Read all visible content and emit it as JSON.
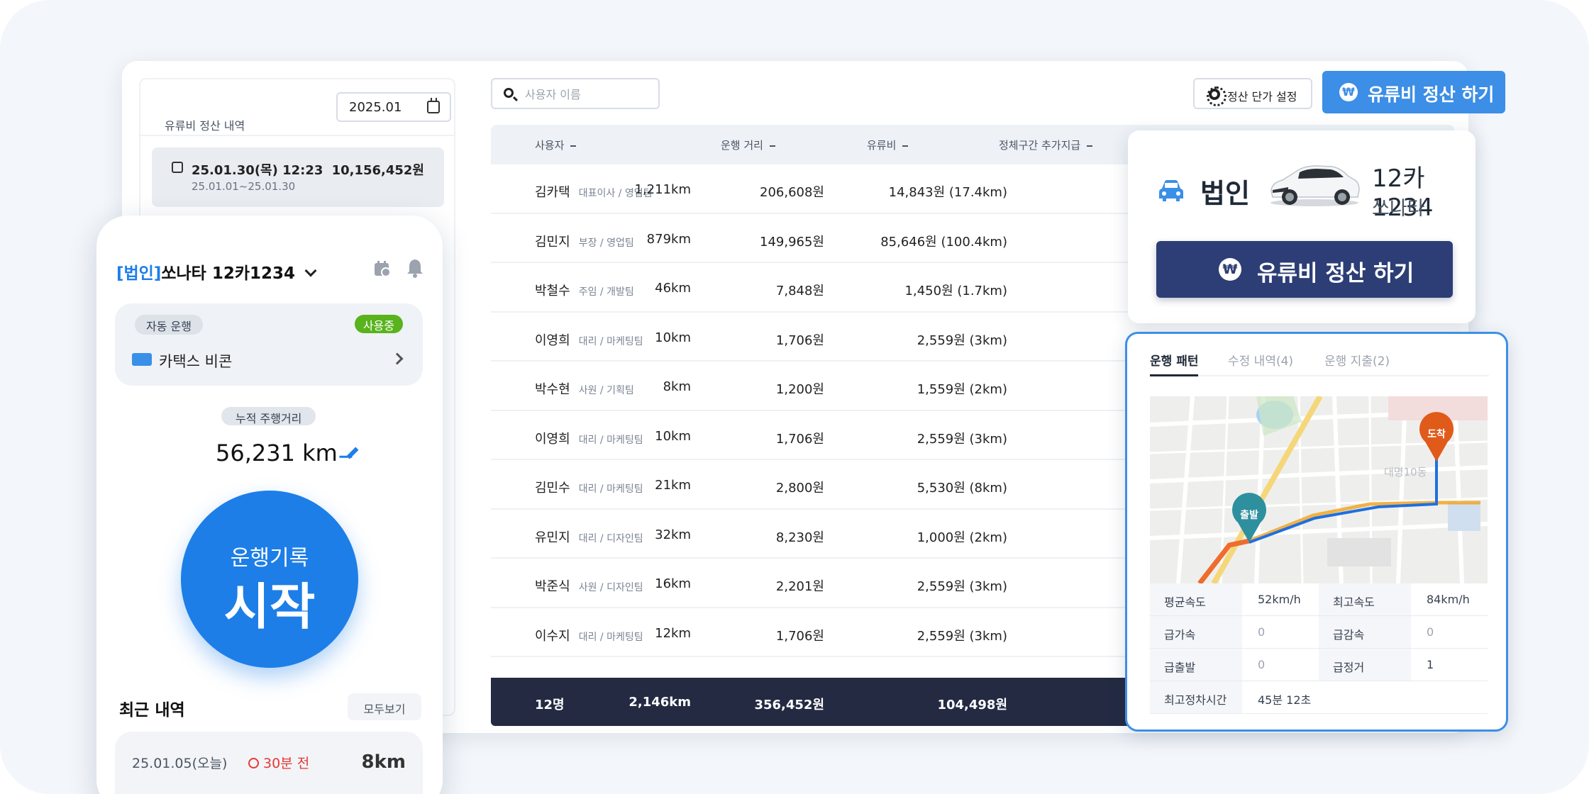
{
  "left_panel": {
    "title": "유류비 정산 내역",
    "month": "2025.01",
    "item": {
      "datetime": "25.01.30(목) 12:23",
      "range": "25.01.01~25.01.30",
      "amount": "10,156,452원"
    }
  },
  "search": {
    "placeholder": "사용자 이름"
  },
  "toolbar": {
    "settings_label": "정산 단가 설정",
    "settle_label": "유류비 정산 하기"
  },
  "table": {
    "headers": [
      "사용자",
      "운행 거리",
      "유류비",
      "정체구간 추가지급"
    ],
    "rows": [
      {
        "name": "김카택",
        "role": "대표이사 / 영업팀",
        "distance": "1,211km",
        "fuel": "206,608원",
        "extra": "14,843원 (17.4km)"
      },
      {
        "name": "김민지",
        "role": "부장 / 영업팀",
        "distance": "879km",
        "fuel": "149,965원",
        "extra": "85,646원 (100.4km)"
      },
      {
        "name": "박철수",
        "role": "주임 / 개발팀",
        "distance": "46km",
        "fuel": "7,848원",
        "extra": "1,450원 (1.7km)"
      },
      {
        "name": "이영희",
        "role": "대리 / 마케팅팀",
        "distance": "10km",
        "fuel": "1,706원",
        "extra": "2,559원 (3km)"
      },
      {
        "name": "박수현",
        "role": "사원 / 기획팀",
        "distance": "8km",
        "fuel": "1,200원",
        "extra": "1,559원 (2km)"
      },
      {
        "name": "이영희",
        "role": "대리 / 마케팅팀",
        "distance": "10km",
        "fuel": "1,706원",
        "extra": "2,559원 (3km)"
      },
      {
        "name": "김민수",
        "role": "대리 / 마케팅팀",
        "distance": "21km",
        "fuel": "2,800원",
        "extra": "5,530원 (8km)"
      },
      {
        "name": "유민지",
        "role": "대리 / 디자인팀",
        "distance": "32km",
        "fuel": "8,230원",
        "extra": "1,000원 (2km)"
      },
      {
        "name": "박준식",
        "role": "사원 / 디자인팀",
        "distance": "16km",
        "fuel": "2,201원",
        "extra": "2,559원 (3km)"
      },
      {
        "name": "이수지",
        "role": "대리 / 마케팅팀",
        "distance": "12km",
        "fuel": "1,706원",
        "extra": "2,559원 (3km)"
      }
    ],
    "footer": {
      "count": "12명",
      "distance": "2,146km",
      "fuel": "356,452원",
      "extra": "104,498원"
    }
  },
  "car_card": {
    "kind": "법인",
    "plate": "12카1234",
    "model": "쏘나타",
    "settle_label": "유류비 정산 하기",
    "won_symbol": "₩"
  },
  "trip_card": {
    "tabs": [
      "운행 패턴",
      "수정 내역(4)",
      "운행 지출(2)"
    ],
    "map": {
      "start_label": "출발",
      "end_label": "도착",
      "area_label": "대명10동"
    },
    "stats": {
      "avg_speed_label": "평균속도",
      "avg_speed": "52km/h",
      "max_speed_label": "최고속도",
      "max_speed": "84km/h",
      "hard_accel_label": "급가속",
      "hard_accel": "0",
      "hard_decel_label": "급감속",
      "hard_decel": "0",
      "hard_start_label": "급출발",
      "hard_start": "0",
      "hard_stop_label": "급정거",
      "hard_stop": "1",
      "max_stop_label": "최고정차시간",
      "max_stop": "45분 12초"
    }
  },
  "phone": {
    "title_bracket": "[법인]",
    "title": "쏘나타 12카1234",
    "auto_drive": "자동 운행",
    "in_use": "사용중",
    "beacon_label": "카택스 비콘",
    "cumulative_label": "누적 주행거리",
    "odometer": "56,231 km",
    "start_line1": "운행기록",
    "start_line2": "시작",
    "recent_title": "최근 내역",
    "see_all": "모두보기",
    "recent_item": {
      "date": "25.01.05(오늘)",
      "ago": "30분 전",
      "distance": "8km"
    }
  },
  "colors": {
    "primary": "#1d7ee8",
    "settle_button": "#3c8ee6",
    "navy": "#2c3e75",
    "footer": "#232a42",
    "in_use": "#58b31d",
    "alert": "#e53935"
  }
}
